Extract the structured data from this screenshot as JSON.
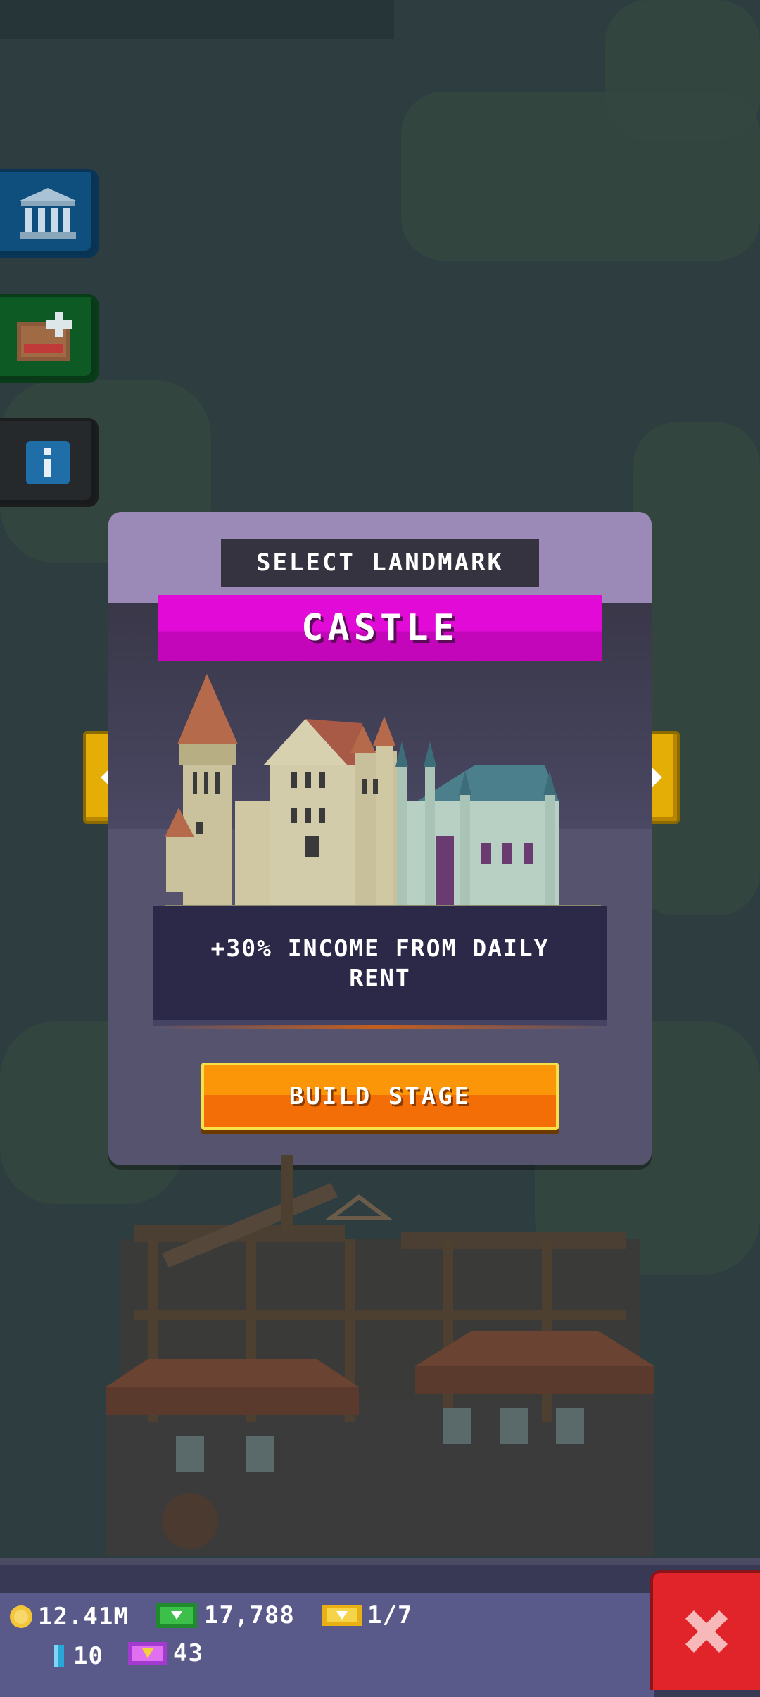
{
  "dialog": {
    "header": "SELECT LANDMARK",
    "landmark_name": "CASTLE",
    "description": "+30% INCOME FROM DAILY RENT",
    "build_button": "BUILD STAGE"
  },
  "resources": {
    "coins": "12.41M",
    "bux": "17,788",
    "tickets": "1/7",
    "gems": "10",
    "vip_tickets": "43"
  },
  "icons": {
    "side_buttons": [
      "museum-icon",
      "quest-icon",
      "info-icon"
    ],
    "close": "close-icon",
    "nav_left": "arrow-left-icon",
    "nav_right": "arrow-right-icon"
  },
  "colors": {
    "banner": "#e20ad6",
    "build_button": "#fb9608",
    "close_button": "#e0242a",
    "arrow_button": "#e4ae06"
  }
}
